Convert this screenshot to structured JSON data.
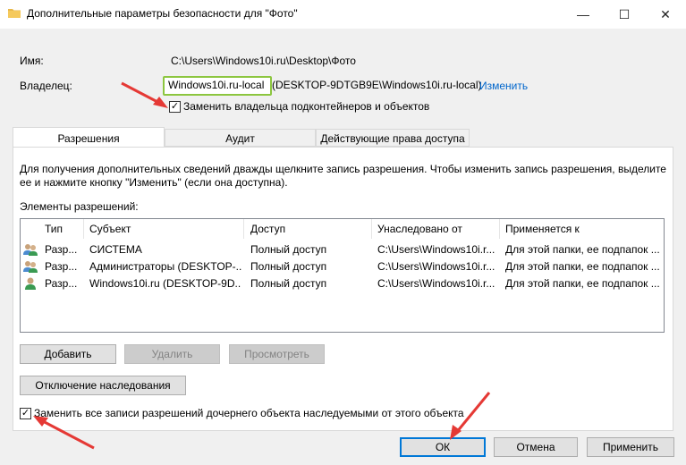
{
  "window": {
    "title": "Дополнительные параметры безопасности  для \"Фото\"",
    "minimize_glyph": "—",
    "maximize_glyph": "☐",
    "close_glyph": "✕"
  },
  "name_label": "Имя:",
  "name_value": "C:\\Users\\Windows10i.ru\\Desktop\\Фото",
  "owner_label": "Владелец:",
  "owner_value": "Windows10i.ru-local",
  "owner_value_rest": "(DESKTOP-9DTGB9E\\Windows10i.ru-local)",
  "owner_change_link": "Изменить",
  "replace_owner_checkbox": {
    "label": "Заменить владельца подконтейнеров и объектов",
    "checked": true
  },
  "tabs": [
    {
      "label": "Разрешения",
      "active": true
    },
    {
      "label": "Аудит",
      "active": false
    },
    {
      "label": "Действующие права доступа",
      "active": false
    }
  ],
  "info_text_line1": "Для получения дополнительных сведений дважды щелкните запись разрешения. Чтобы изменить запись разрешения, выделите",
  "info_text_line2": "ее и нажмите кнопку \"Изменить\" (если она доступна).",
  "entries_label": "Элементы разрешений:",
  "table": {
    "columns": [
      "Тип",
      "Субъект",
      "Доступ",
      "Унаследовано от",
      "Применяется к"
    ],
    "rows": [
      {
        "icon": "users-group-icon",
        "type": "Разр...",
        "subject": "СИСТЕМА",
        "access": "Полный доступ",
        "inherited": "C:\\Users\\Windows10i.r...",
        "applies": "Для этой папки, ее подпапок ..."
      },
      {
        "icon": "users-group-icon",
        "type": "Разр...",
        "subject": "Администраторы (DESKTOP-...",
        "access": "Полный доступ",
        "inherited": "C:\\Users\\Windows10i.r...",
        "applies": "Для этой папки, ее подпапок ..."
      },
      {
        "icon": "user-icon",
        "type": "Разр...",
        "subject": "Windows10i.ru (DESKTOP-9D...",
        "access": "Полный доступ",
        "inherited": "C:\\Users\\Windows10i.r...",
        "applies": "Для этой папки, ее подпапок ..."
      }
    ]
  },
  "buttons": {
    "add": "Добавить",
    "remove": "Удалить",
    "view": "Просмотреть",
    "disable_inheritance": "Отключение наследования",
    "ok": "ОК",
    "cancel": "Отмена",
    "apply": "Применить"
  },
  "replace_child_checkbox": {
    "label": "Заменить все записи разрешений дочернего объекта наследуемыми от этого объекта",
    "checked": true
  },
  "colors": {
    "accent": "#0078d7",
    "highlight_box": "#8cc63f",
    "arrow": "#e53935",
    "link": "#0066cc"
  }
}
